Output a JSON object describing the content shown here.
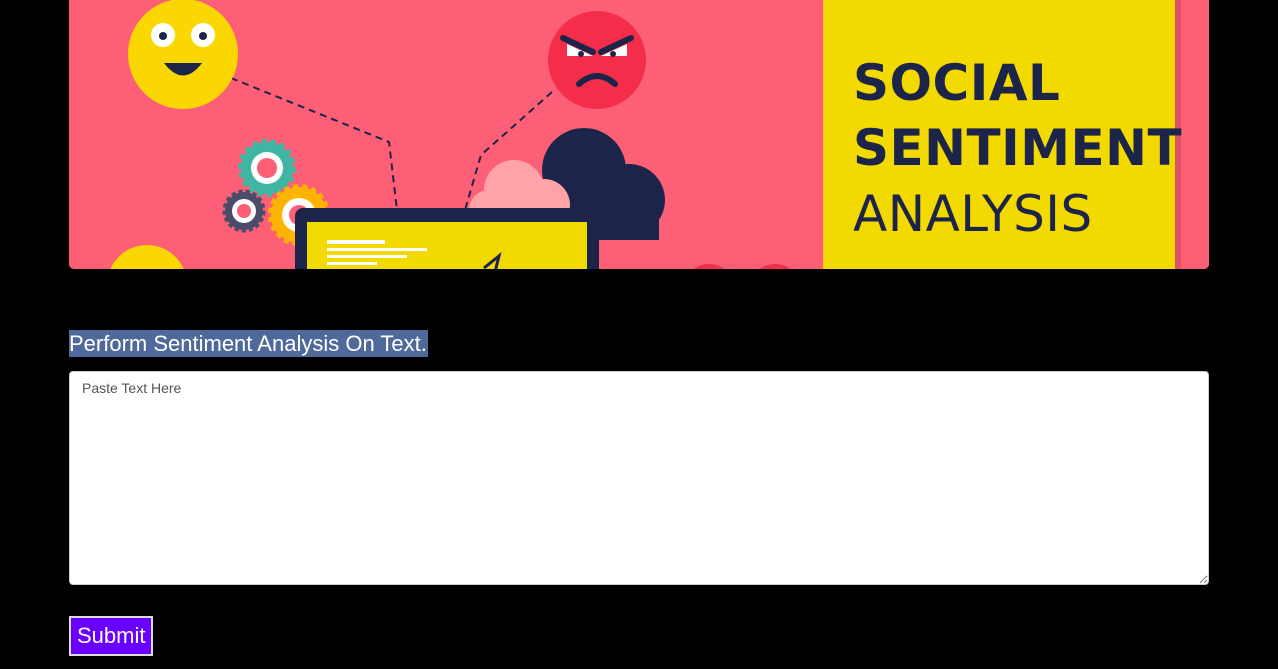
{
  "banner": {
    "title_lines": [
      "SOCIAL",
      "SENTIMENT",
      "ANALYSIS"
    ],
    "colors": {
      "background": "#fd5f76",
      "panel": "#f2d900",
      "title": "#1c2549",
      "cloud_dark": "#1c2549",
      "cloud_light": "#ffa3a8"
    },
    "illustration_icons": [
      "happy-face-icon",
      "angry-face-icon",
      "gear-icon",
      "cloud-icon",
      "laptop-icon"
    ]
  },
  "form": {
    "heading": "Perform Sentiment Analysis On Text.",
    "textarea_placeholder": "Paste Text Here",
    "textarea_value": "",
    "submit_label": "Submit"
  },
  "colors": {
    "page_background": "#000000",
    "heading_highlight": "#4f6a9a",
    "submit_background": "#6a00ff"
  }
}
